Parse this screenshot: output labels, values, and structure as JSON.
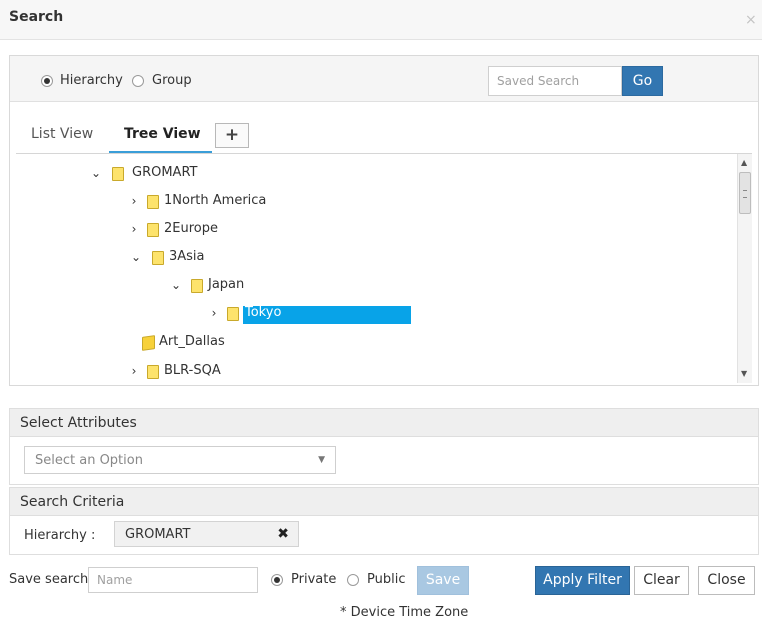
{
  "dialog": {
    "title": "Search",
    "close_glyph": "×"
  },
  "mode": {
    "options": [
      {
        "label": "Hierarchy",
        "selected": true
      },
      {
        "label": "Group",
        "selected": false
      }
    ]
  },
  "saved_search": {
    "placeholder": "Saved Search",
    "go_label": "Go"
  },
  "tabs": [
    {
      "label": "List View",
      "active": false
    },
    {
      "label": "Tree View",
      "active": true
    }
  ],
  "add_tab_glyph": "+",
  "tree": {
    "nodes": [
      {
        "label": "GROMART",
        "expanded": true,
        "icon": "folder-icon"
      },
      {
        "label": "1North America",
        "expanded": false,
        "icon": "folder-icon"
      },
      {
        "label": "2Europe",
        "expanded": false,
        "icon": "folder-icon"
      },
      {
        "label": "3Asia",
        "expanded": true,
        "icon": "folder-icon"
      },
      {
        "label": "Japan",
        "expanded": true,
        "icon": "folder-icon"
      },
      {
        "label": "Tokyo",
        "expanded": false,
        "selected": true,
        "icon": "folder-icon"
      },
      {
        "label": "Art_Dallas",
        "leaf": true,
        "icon": "open-folder-icon"
      },
      {
        "label": "BLR-SQA",
        "expanded": false,
        "icon": "folder-icon"
      }
    ]
  },
  "select_attributes": {
    "header": "Select Attributes",
    "placeholder": "Select an Option"
  },
  "search_criteria": {
    "header": "Search Criteria",
    "label": "Hierarchy :",
    "value": "GROMART",
    "remove_glyph": "✖"
  },
  "footer": {
    "save_search_label": "Save search:",
    "name_placeholder": "Name",
    "visibility": [
      {
        "label": "Private",
        "selected": true
      },
      {
        "label": "Public",
        "selected": false
      }
    ],
    "save_label": "Save",
    "apply_label": "Apply Filter",
    "clear_label": "Clear",
    "close_label": "Close",
    "timezone_note": "* Device Time Zone"
  },
  "colors": {
    "primary": "#3276b1",
    "selection": "#08a3e8",
    "tab_underline": "#3a9ed8",
    "folder": "#fde36c"
  }
}
